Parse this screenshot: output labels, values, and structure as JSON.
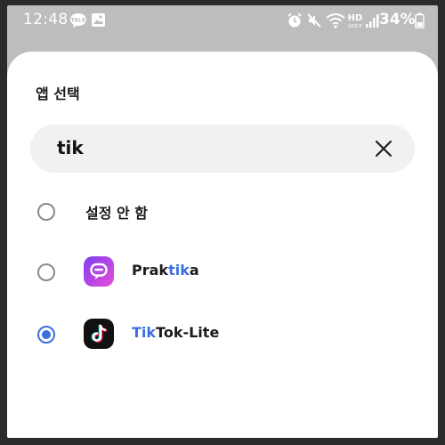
{
  "status_bar": {
    "time": "12:48",
    "battery_percent": "34%",
    "icons": [
      "talk-icon",
      "gallery-icon",
      "alarm-icon",
      "mute-icon",
      "wifi-icon",
      "hd-voice-icon",
      "signal-icon",
      "battery-icon"
    ]
  },
  "sheet": {
    "title": "앱 선택",
    "search": {
      "value": "tik",
      "placeholder": ""
    }
  },
  "options": [
    {
      "label": "설정 안 함",
      "selected": false
    },
    {
      "label_pre": "Prak",
      "label_match": "tik",
      "label_post": "a",
      "icon": "praktika-app-icon",
      "selected": false
    },
    {
      "label_pre": "",
      "label_match": "Tik",
      "label_post": "Tok-Lite",
      "icon": "tiktok-lite-app-icon",
      "selected": true
    }
  ],
  "colors": {
    "accent": "#3b6fe0",
    "praktika_gradient_start": "#7b3ff2",
    "praktika_gradient_end": "#e94cd7",
    "tiktok_bg": "#111111",
    "tiktok_cyan": "#25f4ee",
    "tiktok_red": "#fe2c55"
  }
}
